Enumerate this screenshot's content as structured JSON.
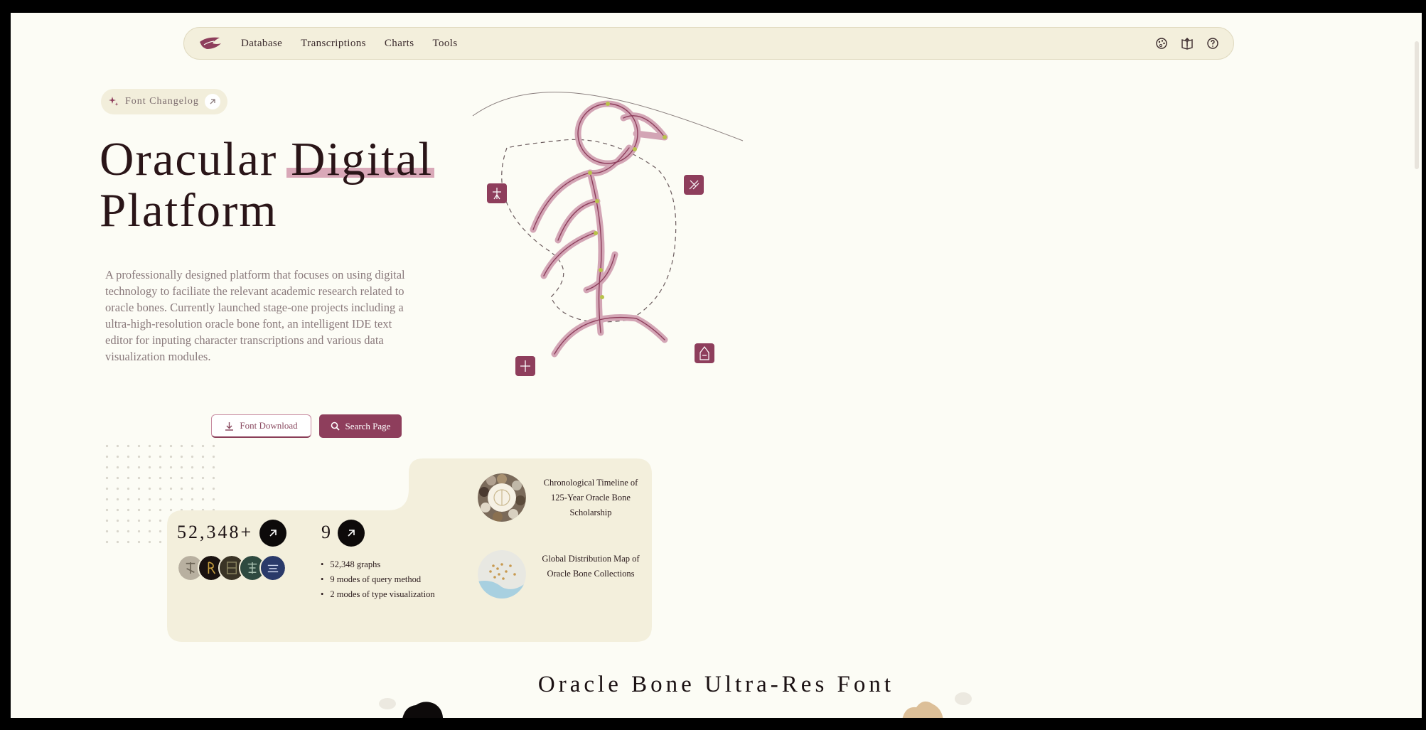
{
  "nav": {
    "links": [
      "Database",
      "Transcriptions",
      "Charts",
      "Tools"
    ],
    "icons": [
      "palette-icon",
      "book-upload-icon",
      "help-icon"
    ]
  },
  "changelog": {
    "label": "Font Changelog"
  },
  "hero": {
    "title_word1": "Oracular",
    "title_word2": "Digital",
    "title_line2": "Platform",
    "description": "A professionally designed platform that focuses on using digital technology to faciliate the relevant academic research related to oracle bones. Currently launched stage-one projects including a ultra-high-resolution oracle bone font, an intelligent IDE text editor for inputing character transcriptions and various data visualization modules."
  },
  "buttons": {
    "download": "Font Download",
    "search": "Search Page"
  },
  "stats": {
    "count": "52,348+",
    "count2": "9",
    "bullets": [
      "52,348 graphs",
      "9 modes of query method",
      "2 modes of type visualization"
    ]
  },
  "features": [
    {
      "label": "Chronological Timeline of 125-Year Oracle Bone Scholarship"
    },
    {
      "label": "Global Distribution Map of Oracle Bone Collections"
    }
  ],
  "section": {
    "title_pre": "Oracle Bone",
    "title_hl": "Ultra-Res",
    "title_post": "Font"
  },
  "colors": {
    "accent": "#8e3e5c",
    "accent_light": "#d9a8b8",
    "card": "#f3efdc",
    "background": "#fcfcf5"
  }
}
